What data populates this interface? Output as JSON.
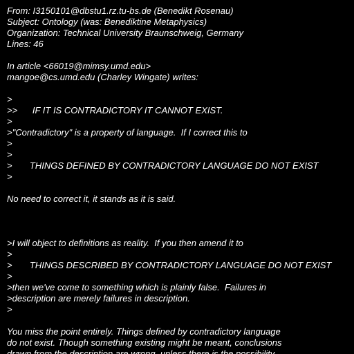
{
  "colors": {
    "background": "#000000",
    "text": "#ffffff"
  },
  "lines": [
    "From: I3150101@dbstu1.rz.tu-bs.de (Benedikt Rosenau)",
    "Subject: Ontology (was: Benediktine Metaphysics)",
    "Organization: Technical University Braunschweig, Germany",
    "Lines: 46",
    "",
    "In article <66019@mimsy.umd.edu>",
    "mangoe@cs.umd.edu (Charley Wingate) writes:",
    "",
    ">",
    ">>      IF IT IS CONTRADICTORY IT CANNOT EXIST.",
    ">",
    ">\"Contradictory\" is a property of language.  If I correct this to",
    ">",
    ">",
    ">       THINGS DEFINED BY CONTRADICTORY LANGUAGE DO NOT EXIST",
    ">",
    "",
    "No need to correct it, it stands as it is said.",
    "",
    "",
    "",
    ">I will object to definitions as reality.  If you then amend it to",
    ">",
    ">       THINGS DESCRIBED BY CONTRADICTORY LANGUAGE DO NOT EXIST",
    ">",
    ">then we've come to something which is plainly false.  Failures in",
    ">description are merely failures in description.",
    ">",
    "",
    "You miss the point entirely. Things defined by contradictory language",
    "do not exist. Though something existing might be meant, conclusions",
    "drawn from the description are wrong, unless there is the possibility"
  ]
}
